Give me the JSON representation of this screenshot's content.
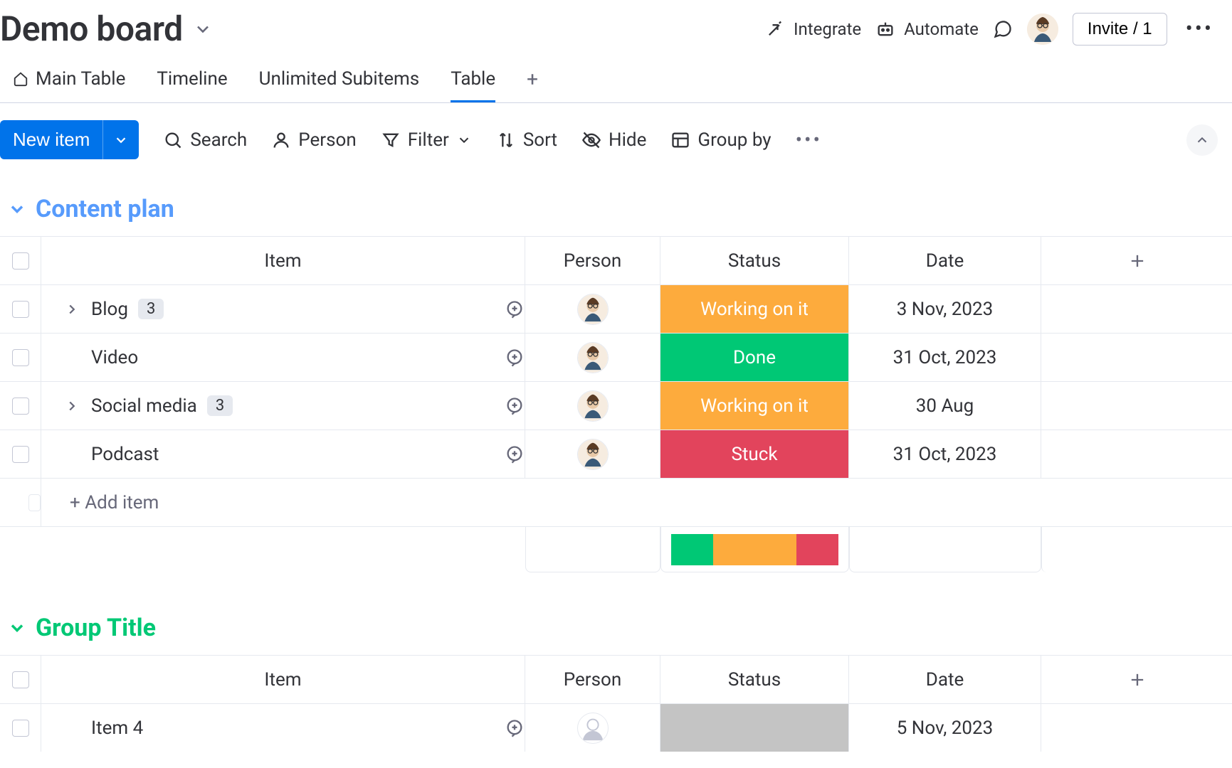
{
  "header": {
    "board_title": "Demo board",
    "integrate": "Integrate",
    "automate": "Automate",
    "invite": "Invite / 1"
  },
  "tabs": [
    {
      "label": "Main Table",
      "home": true,
      "active": false
    },
    {
      "label": "Timeline",
      "home": false,
      "active": false
    },
    {
      "label": "Unlimited Subitems",
      "home": false,
      "active": false
    },
    {
      "label": "Table",
      "home": false,
      "active": true
    }
  ],
  "toolbar": {
    "new_item": "New item",
    "search": "Search",
    "person": "Person",
    "filter": "Filter",
    "sort": "Sort",
    "hide": "Hide",
    "group_by": "Group by"
  },
  "columns": {
    "item": "Item",
    "person": "Person",
    "status": "Status",
    "date": "Date"
  },
  "add_item": "+ Add item",
  "status_labels": {
    "working": "Working on it",
    "done": "Done",
    "stuck": "Stuck"
  },
  "groups": [
    {
      "title": "Content plan",
      "color": "blue",
      "rows": [
        {
          "name": "Blog",
          "subitems": 3,
          "has_sub": true,
          "status": "working",
          "date": "3 Nov, 2023",
          "person": "avatar"
        },
        {
          "name": "Video",
          "subitems": null,
          "has_sub": false,
          "status": "done",
          "date": "31 Oct, 2023",
          "person": "avatar"
        },
        {
          "name": "Social media",
          "subitems": 3,
          "has_sub": true,
          "status": "working",
          "date": "30 Aug",
          "person": "avatar"
        },
        {
          "name": "Podcast",
          "subitems": null,
          "has_sub": false,
          "status": "stuck",
          "date": "31 Oct, 2023",
          "person": "avatar"
        }
      ],
      "summary": {
        "done": 25,
        "working": 50,
        "stuck": 25
      }
    },
    {
      "title": "Group Title",
      "color": "green",
      "rows": [
        {
          "name": "Item 4",
          "subitems": null,
          "has_sub": false,
          "status": "blank",
          "date": "5 Nov, 2023",
          "person": "empty"
        }
      ],
      "summary": null
    }
  ]
}
